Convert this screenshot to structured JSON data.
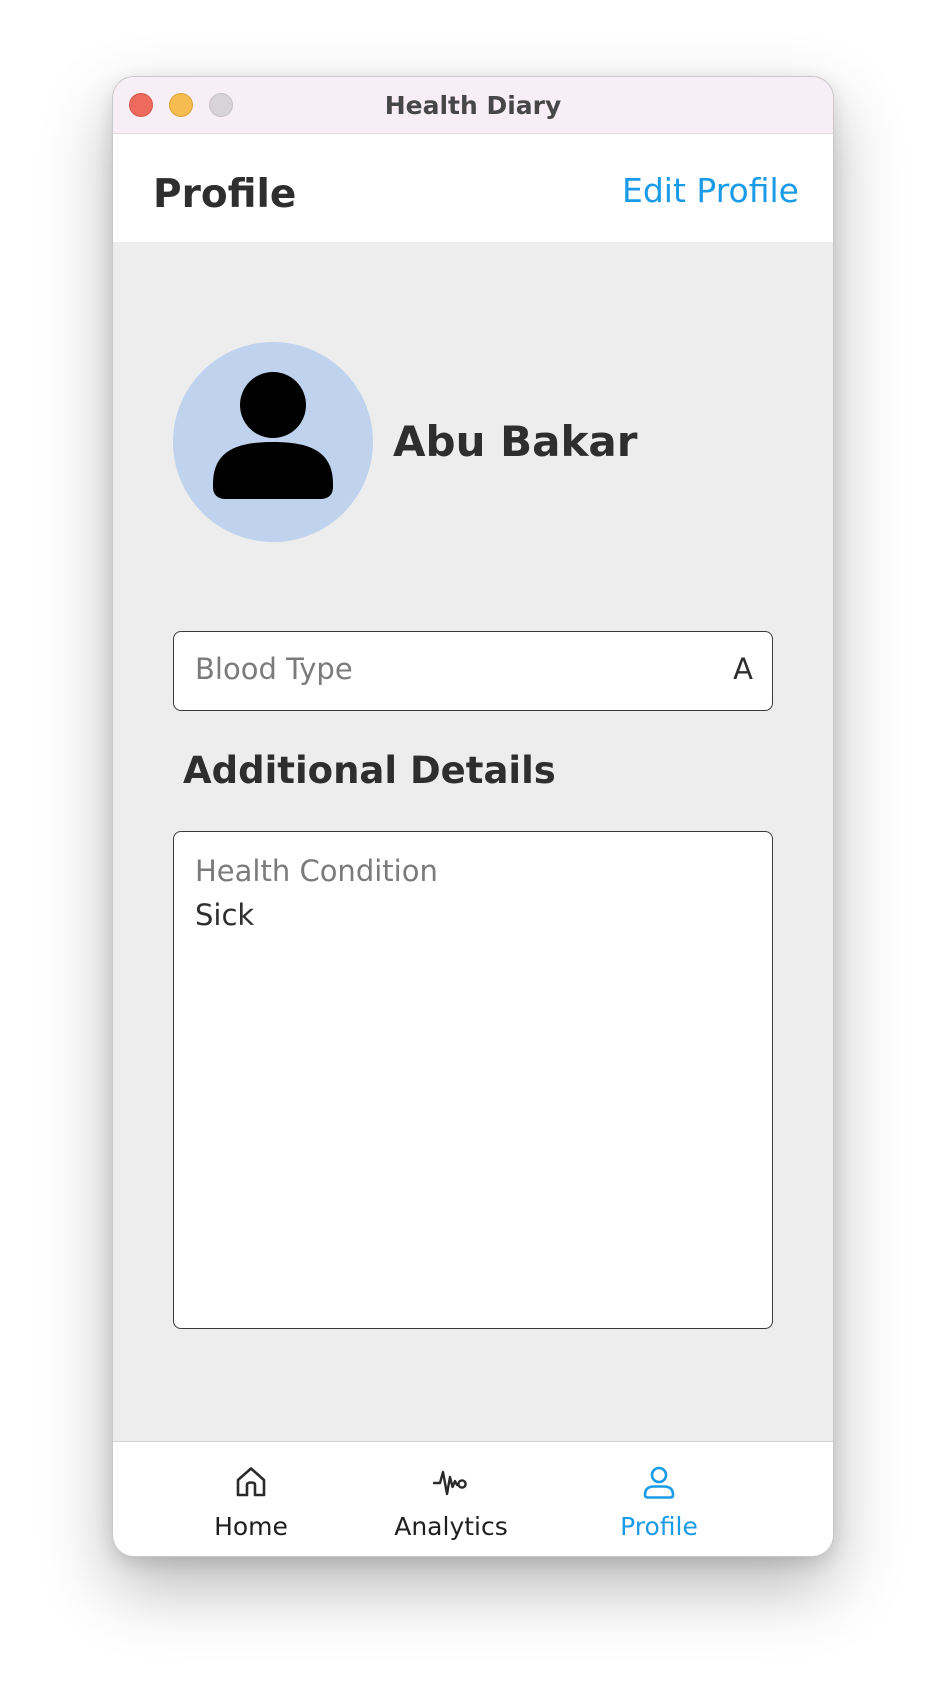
{
  "window": {
    "title": "Health Diary"
  },
  "header": {
    "title": "Profile",
    "edit_label": "Edit Profile"
  },
  "profile": {
    "name": "Abu Bakar",
    "avatar_icon": "person-icon",
    "avatar_color": "#bfd3ee"
  },
  "blood_type": {
    "label": "Blood Type",
    "value": "A"
  },
  "additional": {
    "title": "Additional Details",
    "health_condition": {
      "label": "Health Condition",
      "value": "Sick"
    }
  },
  "tabs": [
    {
      "label": "Home",
      "icon": "home-icon",
      "active": false
    },
    {
      "label": "Analytics",
      "icon": "pulse-icon",
      "active": false
    },
    {
      "label": "Profile",
      "icon": "person-icon",
      "active": true
    }
  ],
  "colors": {
    "accent": "#1a9be8",
    "background": "#ededed",
    "titlebar": "#f7eff5"
  }
}
